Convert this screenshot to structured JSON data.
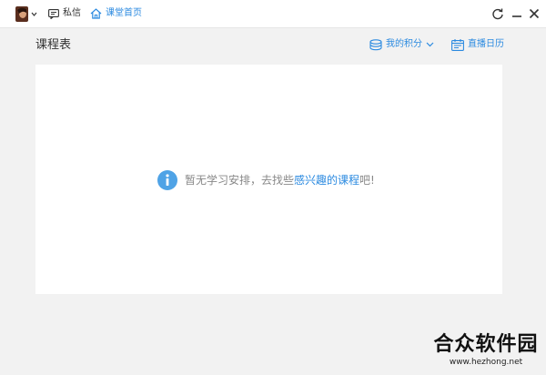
{
  "titlebar": {
    "messages_label": "私信",
    "home_label": "课堂首页"
  },
  "header": {
    "title": "课程表",
    "points_label": "我的积分",
    "live_calendar_label": "直播日历"
  },
  "empty_state": {
    "text_before": "暂无学习安排，去找些",
    "link_text": "感兴趣的课程",
    "text_after": "吧!"
  },
  "watermark": {
    "title": "合众软件园",
    "url": "www.hezhong.net"
  },
  "colors": {
    "accent": "#2b8ae0",
    "background": "#f2f2f2",
    "card": "#ffffff",
    "info_icon": "#4fa3e6"
  },
  "icons": {
    "avatar": "user-avatar",
    "messages": "message-icon",
    "home": "home-icon",
    "refresh": "refresh-icon",
    "minimize": "minimize-icon",
    "close": "close-icon",
    "points": "coin-stack-icon",
    "calendar": "calendar-icon",
    "info": "info-icon"
  }
}
